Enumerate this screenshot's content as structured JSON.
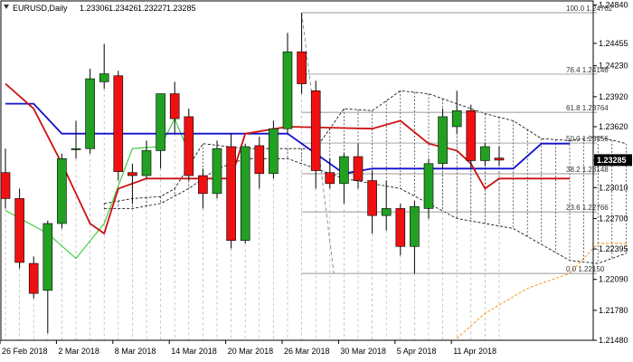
{
  "header": {
    "symbol": "EURUSD,Daily",
    "open": "1.23306",
    "high": "1.23426",
    "low": "1.23227",
    "close": "1.23285"
  },
  "price_tag": "1.23285",
  "colors": {
    "bull": "#22a022",
    "bear": "#ee1111",
    "cloud": "#000000",
    "kijun": "#1010cc",
    "tenkan": "#cc1111",
    "chikou": "#33cc33",
    "lower_band": "#ff8800",
    "fib": "#777777",
    "grid": "#b0b0b0",
    "axis": "#000000",
    "price_tag_bg": "#000000"
  },
  "chart_data": {
    "type": "candlestick",
    "title": "EURUSD,Daily",
    "ylim": [
      1.2148,
      1.2488
    ],
    "y_ticks": [
      "1.24840",
      "1.24455",
      "1.24230",
      "1.23920",
      "1.23620",
      "1.23285",
      "1.23010",
      "1.22700",
      "1.22395",
      "1.22090",
      "1.21780",
      "1.21480"
    ],
    "x_tick_labels": [
      "26 Feb 2018",
      "2 Mar 2018",
      "8 Mar 2018",
      "14 Mar 2018",
      "20 Mar 2018",
      "26 Mar 2018",
      "30 Mar 2018",
      "5 Apr 2018",
      "11 Apr 2018"
    ],
    "x_tick_bars": [
      0,
      4,
      8,
      12,
      16,
      20,
      24,
      28,
      32
    ],
    "candles": [
      {
        "o": 1.2316,
        "h": 1.234,
        "l": 1.228,
        "c": 1.229
      },
      {
        "o": 1.229,
        "h": 1.23,
        "l": 1.222,
        "c": 1.2226
      },
      {
        "o": 1.2225,
        "h": 1.2232,
        "l": 1.219,
        "c": 1.2195
      },
      {
        "o": 1.2198,
        "h": 1.2268,
        "l": 1.2155,
        "c": 1.2265
      },
      {
        "o": 1.2265,
        "h": 1.2335,
        "l": 1.226,
        "c": 1.233
      },
      {
        "o": 1.234,
        "h": 1.2368,
        "l": 1.233,
        "c": 1.234
      },
      {
        "o": 1.234,
        "h": 1.242,
        "l": 1.2335,
        "c": 1.241
      },
      {
        "o": 1.2407,
        "h": 1.2445,
        "l": 1.24,
        "c": 1.2415
      },
      {
        "o": 1.2413,
        "h": 1.2418,
        "l": 1.2308,
        "c": 1.2317
      },
      {
        "o": 1.2316,
        "h": 1.2325,
        "l": 1.2285,
        "c": 1.2313
      },
      {
        "o": 1.2313,
        "h": 1.2348,
        "l": 1.231,
        "c": 1.2338
      },
      {
        "o": 1.2338,
        "h": 1.2395,
        "l": 1.232,
        "c": 1.2395
      },
      {
        "o": 1.2395,
        "h": 1.2407,
        "l": 1.2355,
        "c": 1.237
      },
      {
        "o": 1.2372,
        "h": 1.238,
        "l": 1.2308,
        "c": 1.2313
      },
      {
        "o": 1.2313,
        "h": 1.232,
        "l": 1.228,
        "c": 1.2295
      },
      {
        "o": 1.2295,
        "h": 1.2348,
        "l": 1.229,
        "c": 1.234
      },
      {
        "o": 1.2342,
        "h": 1.2355,
        "l": 1.224,
        "c": 1.2248
      },
      {
        "o": 1.2248,
        "h": 1.2345,
        "l": 1.2245,
        "c": 1.2342
      },
      {
        "o": 1.2343,
        "h": 1.2352,
        "l": 1.23,
        "c": 1.2315
      },
      {
        "o": 1.2315,
        "h": 1.2368,
        "l": 1.231,
        "c": 1.236
      },
      {
        "o": 1.236,
        "h": 1.2456,
        "l": 1.2355,
        "c": 1.2437
      },
      {
        "o": 1.2437,
        "h": 1.2476,
        "l": 1.2395,
        "c": 1.2405
      },
      {
        "o": 1.2398,
        "h": 1.2408,
        "l": 1.23,
        "c": 1.2318
      },
      {
        "o": 1.2316,
        "h": 1.233,
        "l": 1.23,
        "c": 1.2305
      },
      {
        "o": 1.2305,
        "h": 1.2335,
        "l": 1.2285,
        "c": 1.2332
      },
      {
        "o": 1.2332,
        "h": 1.2345,
        "l": 1.23,
        "c": 1.2308
      },
      {
        "o": 1.2308,
        "h": 1.2318,
        "l": 1.2255,
        "c": 1.2273
      },
      {
        "o": 1.2273,
        "h": 1.2308,
        "l": 1.2258,
        "c": 1.228
      },
      {
        "o": 1.228,
        "h": 1.2285,
        "l": 1.2233,
        "c": 1.2242
      },
      {
        "o": 1.2242,
        "h": 1.2288,
        "l": 1.2215,
        "c": 1.2282
      },
      {
        "o": 1.228,
        "h": 1.233,
        "l": 1.227,
        "c": 1.2325
      },
      {
        "o": 1.2325,
        "h": 1.238,
        "l": 1.232,
        "c": 1.2372
      },
      {
        "o": 1.2362,
        "h": 1.2398,
        "l": 1.2355,
        "c": 1.2378
      },
      {
        "o": 1.2378,
        "h": 1.2384,
        "l": 1.232,
        "c": 1.2328
      },
      {
        "o": 1.2328,
        "h": 1.2346,
        "l": 1.2323,
        "c": 1.2342
      },
      {
        "o": 1.23306,
        "h": 1.23426,
        "l": 1.23227,
        "c": 1.23285
      }
    ],
    "tenkan": [
      [
        0,
        1.2405
      ],
      [
        2,
        1.238
      ],
      [
        4,
        1.2325
      ],
      [
        6,
        1.2265
      ],
      [
        7,
        1.2255
      ],
      [
        8,
        1.23
      ],
      [
        10,
        1.231
      ],
      [
        16,
        1.231
      ],
      [
        17,
        1.2355
      ],
      [
        20,
        1.2362
      ],
      [
        26,
        1.236
      ],
      [
        28,
        1.2368
      ],
      [
        30,
        1.2345
      ],
      [
        32,
        1.2338
      ],
      [
        33,
        1.2325
      ],
      [
        34,
        1.23
      ],
      [
        35,
        1.231
      ],
      [
        40,
        1.231
      ]
    ],
    "kijun": [
      [
        0,
        1.2385
      ],
      [
        2,
        1.2385
      ],
      [
        4,
        1.2355
      ],
      [
        20,
        1.2355
      ],
      [
        24,
        1.2315
      ],
      [
        26,
        1.232
      ],
      [
        36,
        1.232
      ],
      [
        38,
        1.2345
      ],
      [
        40,
        1.2345
      ]
    ],
    "chikou": [
      [
        0,
        1.2278
      ],
      [
        3,
        1.2255
      ],
      [
        5,
        1.223
      ],
      [
        7,
        1.2265
      ],
      [
        9,
        1.234
      ],
      [
        11,
        1.2342
      ],
      [
        12,
        1.237
      ],
      [
        13,
        1.2336
      ]
    ],
    "cloud_upper": [
      [
        7,
        1.2285
      ],
      [
        9,
        1.229
      ],
      [
        11,
        1.2292
      ],
      [
        12,
        1.23
      ],
      [
        14,
        1.2345
      ],
      [
        17,
        1.234
      ],
      [
        22,
        1.234
      ],
      [
        24,
        1.238
      ],
      [
        26,
        1.2378
      ],
      [
        28,
        1.2398
      ],
      [
        30,
        1.2395
      ],
      [
        32,
        1.2385
      ],
      [
        34,
        1.2375
      ],
      [
        36,
        1.2368
      ],
      [
        38,
        1.235
      ],
      [
        40,
        1.2348
      ],
      [
        42,
        1.2352
      ],
      [
        44,
        1.2345
      ]
    ],
    "cloud_lower": [
      [
        7,
        1.228
      ],
      [
        9,
        1.228
      ],
      [
        11,
        1.2285
      ],
      [
        13,
        1.23
      ],
      [
        15,
        1.232
      ],
      [
        17,
        1.233
      ],
      [
        20,
        1.233
      ],
      [
        22,
        1.232
      ],
      [
        24,
        1.231
      ],
      [
        28,
        1.23
      ],
      [
        32,
        1.227
      ],
      [
        36,
        1.226
      ],
      [
        40,
        1.2228
      ],
      [
        42,
        1.2225
      ],
      [
        44,
        1.2235
      ]
    ],
    "lower_band": [
      [
        32,
        1.215
      ],
      [
        34,
        1.2175
      ],
      [
        37,
        1.22
      ],
      [
        39,
        1.221
      ],
      [
        40,
        1.2215
      ],
      [
        42,
        1.2245
      ],
      [
        44,
        1.2245
      ]
    ],
    "fib_levels": [
      {
        "label": "100.0",
        "value": 1.24762
      },
      {
        "label": "76.4",
        "value": 1.24146
      },
      {
        "label": "61.8",
        "value": 1.23764
      },
      {
        "label": "50.0",
        "value": 1.23456
      },
      {
        "label": "38.2",
        "value": 1.23148
      },
      {
        "label": "23.6",
        "value": 1.22766
      },
      {
        "label": "0.0",
        "value": 1.2215
      }
    ],
    "fib_label_text": [
      "1.24762",
      "1.24146",
      "1.23764",
      "1.23456",
      "1.23148",
      "1.22766",
      "1.22150"
    ],
    "fib_start_bar": 21,
    "fib_end_bar": 40,
    "grid": true,
    "legend": "none"
  }
}
